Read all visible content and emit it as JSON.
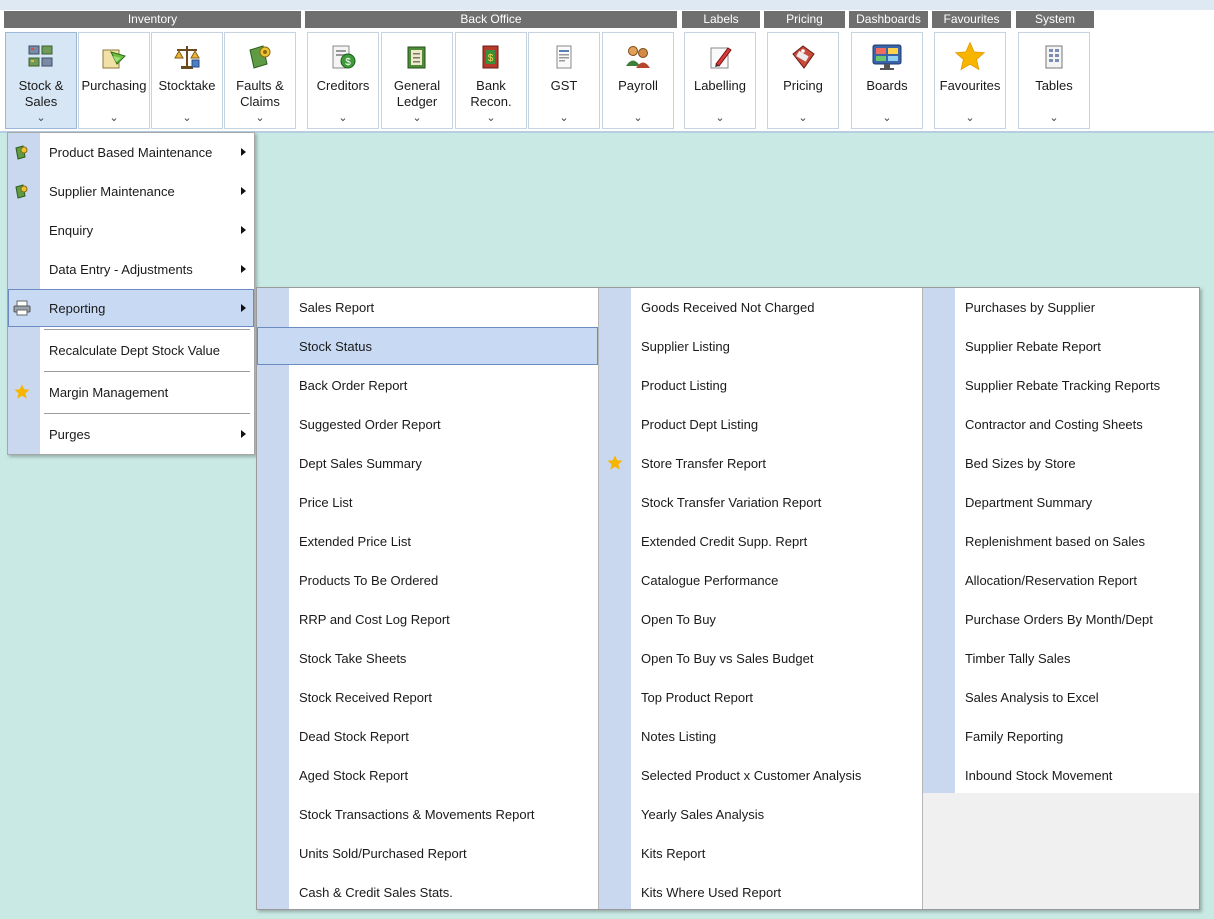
{
  "ribbon": {
    "groups": [
      "Inventory",
      "Back Office",
      "Labels",
      "Pricing",
      "Dashboards",
      "Favourites",
      "System"
    ],
    "buttons": [
      {
        "label": "Stock &\nSales",
        "icon": "stock-sales-icon"
      },
      {
        "label": "Purchasing",
        "icon": "purchasing-icon"
      },
      {
        "label": "Stocktake",
        "icon": "stocktake-scales-icon"
      },
      {
        "label": "Faults &\nClaims",
        "icon": "faults-claims-icon"
      },
      {
        "label": "Creditors",
        "icon": "creditors-icon"
      },
      {
        "label": "General\nLedger",
        "icon": "general-ledger-icon"
      },
      {
        "label": "Bank\nRecon.",
        "icon": "bank-recon-icon"
      },
      {
        "label": "GST",
        "icon": "gst-document-icon"
      },
      {
        "label": "Payroll",
        "icon": "payroll-people-icon"
      },
      {
        "label": "Labelling",
        "icon": "labelling-pencil-icon"
      },
      {
        "label": "Pricing",
        "icon": "pricing-tag-icon"
      },
      {
        "label": "Boards",
        "icon": "boards-monitor-icon"
      },
      {
        "label": "Favourites",
        "icon": "favourites-star-icon"
      },
      {
        "label": "Tables",
        "icon": "tables-icon"
      }
    ],
    "chevron": "⌄"
  },
  "main_menu": {
    "items": [
      {
        "label": "Product Based Maintenance",
        "icon": "package-icon",
        "submenu": true
      },
      {
        "label": "Supplier Maintenance",
        "icon": "package-icon",
        "submenu": true
      },
      {
        "label": "Enquiry",
        "icon": "",
        "submenu": true
      },
      {
        "label": "Data Entry - Adjustments",
        "icon": "",
        "submenu": true
      },
      {
        "label": "Reporting",
        "icon": "printer-icon",
        "submenu": true
      },
      {
        "label": "Recalculate Dept Stock Value",
        "icon": "",
        "submenu": false
      },
      {
        "label": "Margin Management",
        "icon": "star-icon",
        "submenu": false
      },
      {
        "label": "Purges",
        "icon": "",
        "submenu": true
      }
    ]
  },
  "reporting_menu": {
    "col1": [
      "Sales Report",
      "Stock Status",
      "Back Order Report",
      "Suggested Order Report",
      "Dept Sales Summary",
      "Price List",
      "Extended Price List",
      "Products To Be Ordered",
      "RRP and Cost Log Report",
      "Stock Take Sheets",
      "Stock Received Report",
      "Dead Stock Report",
      "Aged Stock Report",
      "Stock Transactions & Movements Report",
      "Units Sold/Purchased Report",
      "Cash & Credit Sales Stats."
    ],
    "col2": [
      "Goods Received Not Charged",
      "Supplier Listing",
      "Product Listing",
      "Product Dept Listing",
      "Store Transfer Report",
      "Stock Transfer Variation Report",
      "Extended Credit Supp. Reprt",
      "Catalogue Performance",
      "Open To Buy",
      "Open To Buy vs Sales Budget",
      "Top Product Report",
      "Notes Listing",
      "Selected Product x Customer Analysis",
      "Yearly Sales Analysis",
      "Kits Report",
      "Kits Where Used Report"
    ],
    "col3": [
      "Purchases by Supplier",
      "Supplier Rebate Report",
      "Supplier Rebate Tracking Reports",
      "Contractor and Costing Sheets",
      "Bed Sizes by Store",
      "Department Summary",
      "Replenishment based on Sales",
      "Allocation/Reservation Report",
      "Purchase Orders By Month/Dept",
      "Timber Tally Sales",
      "Sales Analysis to Excel",
      "Family Reporting",
      "Inbound Stock Movement"
    ]
  },
  "colors": {
    "accent": "#c8daf3",
    "gutter": "#c9d8ef",
    "background": "#c9e9e4",
    "group_header": "#6f6f6f",
    "star": "#f5b800"
  }
}
